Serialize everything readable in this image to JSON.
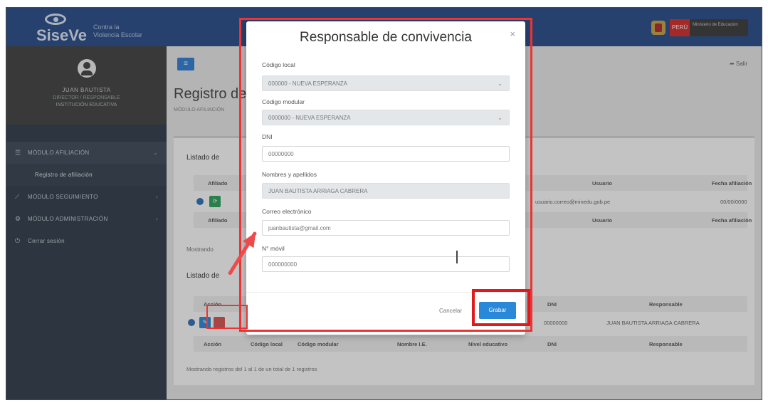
{
  "brand": {
    "logo_text": "SiseVe",
    "logo_sub_line1": "Contra la",
    "logo_sub_line2": "Violencia Escolar",
    "gov_peru": "PERÚ",
    "gov_ministry": "Ministerio de Educación"
  },
  "user": {
    "name": "JUAN BAUTISTA",
    "role": "DIRECTOR / RESPONSABLE",
    "institution": "INSTITUCIÓN EDUCATIVA"
  },
  "sidebar": {
    "items": [
      {
        "label": "MÓDULO AFILIACIÓN",
        "icon": "list-icon"
      },
      {
        "label": "Registro de afiliación"
      },
      {
        "label": "MÓDULO SEGUIMIENTO",
        "icon": "chart-icon"
      },
      {
        "label": "MÓDULO ADMINISTRACIÓN",
        "icon": "gear-icon"
      },
      {
        "label": "Cerrar sesión",
        "icon": "power-icon"
      }
    ]
  },
  "header": {
    "menu_toggle": "≡",
    "logout": "Salir"
  },
  "page": {
    "title": "Registro de",
    "subtitle": "MÓDULO AFILIACIÓN"
  },
  "background": {
    "section1_title": "Listado de",
    "section1_header_afiliado": "Afiliado",
    "section1_header_usuario": "Usuario",
    "section1_header_fecha": "Fecha afiliación",
    "section1_row_usuario": "usuario.correo@minedu.gob.pe",
    "section1_row_fecha": "00/00/0000",
    "showing1": "Mostrando",
    "section2_title": "Listado de",
    "section2_header_accion": "Acción",
    "section2_header_dni": "DNI",
    "section2_header_responsable": "Responsable",
    "section2_row_dni": "00000000",
    "section2_row_responsable": "JUAN BAUTISTA ARRIAGA CABRERA",
    "footer_accion": "Acción",
    "footer_codigo_local": "Código local",
    "footer_codigo_modular": "Código modular",
    "footer_nombre_ie": "Nombre I.E.",
    "footer_nivel": "Nivel educativo",
    "footer_dni": "DNI",
    "footer_responsable": "Responsable",
    "showing2": "Mostrando registros del 1 al 1 de un total de 1 registros"
  },
  "modal": {
    "title": "Responsable de convivencia",
    "close": "×",
    "fields": {
      "codigo_local_label": "Código local",
      "codigo_local_value": "000000 - NUEVA ESPERANZA",
      "codigo_modular_label": "Código modular",
      "codigo_modular_value": "0000000 - NUEVA ESPERANZA",
      "dni_label": "DNI",
      "dni_value": "00000000",
      "nombres_label": "Nombres y apellidos",
      "nombres_value": "JUAN BAUTISTA ARRIAGA CABRERA",
      "correo_label": "Correo electrónico",
      "correo_value": "juanbautista@gmail.com",
      "movil_label": "N° móvil",
      "movil_value": "000000000"
    },
    "cancel_label": "Cancelar",
    "save_label": "Grabar"
  },
  "colors": {
    "topbar": "#274b8a",
    "sidebar": "#2f3b4a",
    "primary": "#2a88d8",
    "highlight": "#e01a1a"
  }
}
